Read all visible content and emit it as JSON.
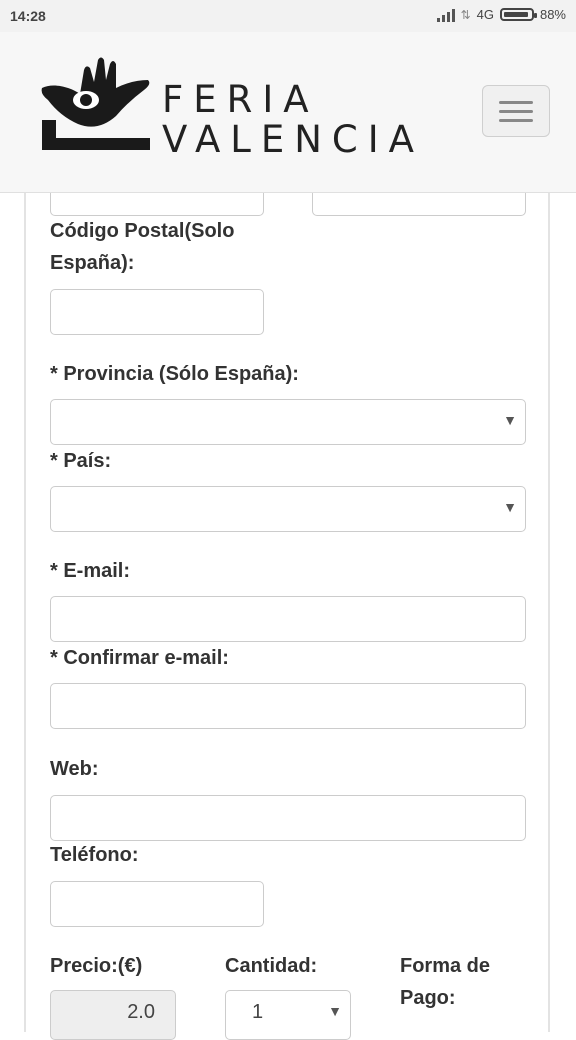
{
  "status_bar": {
    "time": "14:28",
    "network": "4G",
    "battery": "88%",
    "icons": [
      "signal-icon",
      "data-arrows-icon",
      "battery-icon"
    ]
  },
  "header": {
    "brand_line1": "FERIA",
    "brand_line2": "VALENCIA",
    "menu_icon": "hamburger-icon",
    "colors": {
      "text": "#222222",
      "header_bg": "#f7f7f7"
    }
  },
  "form": {
    "postal_code_label": "Código Postal(Solo España):",
    "province_label": "* Provincia (Sólo España):",
    "country_label": "* País:",
    "email_label": "* E-mail:",
    "confirm_email_label": "* Confirmar e-mail:",
    "web_label": "Web:",
    "phone_label": "Teléfono:",
    "price_label": "Precio:(€)",
    "quantity_label": "Cantidad:",
    "payment_label": "Forma de Pago:",
    "price_value": "2.0",
    "quantity_value": "1",
    "select_arrow": "▼"
  }
}
